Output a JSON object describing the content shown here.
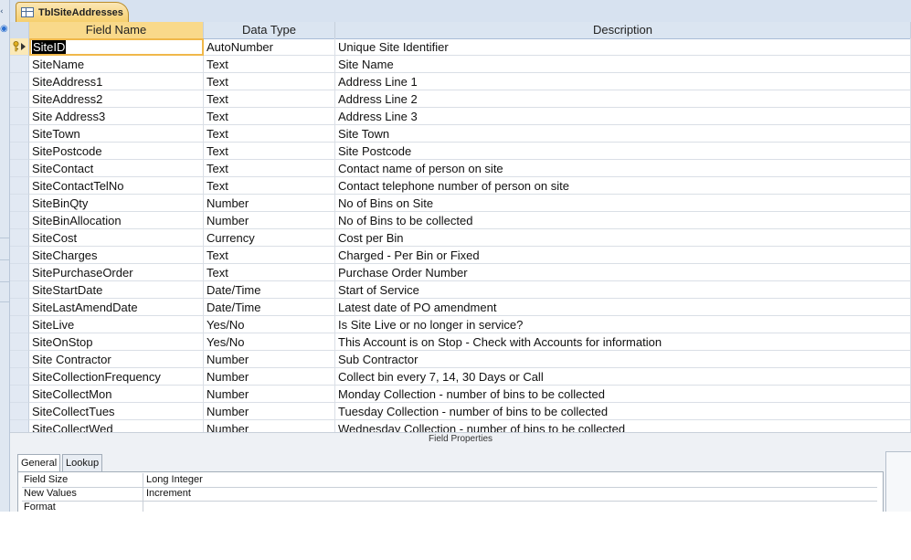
{
  "tab": {
    "title": "TblSiteAddresses"
  },
  "grid": {
    "headers": {
      "selector": "",
      "field_name": "Field Name",
      "data_type": "Data Type",
      "description": "Description"
    },
    "rows": [
      {
        "field": "SiteID",
        "type": "AutoNumber",
        "desc": "Unique Site Identifier"
      },
      {
        "field": "SiteName",
        "type": "Text",
        "desc": "Site Name"
      },
      {
        "field": "SiteAddress1",
        "type": "Text",
        "desc": "Address Line 1"
      },
      {
        "field": "SiteAddress2",
        "type": "Text",
        "desc": "Address Line 2"
      },
      {
        "field": "Site Address3",
        "type": "Text",
        "desc": "Address Line 3"
      },
      {
        "field": "SiteTown",
        "type": "Text",
        "desc": "Site Town"
      },
      {
        "field": "SitePostcode",
        "type": "Text",
        "desc": "Site Postcode"
      },
      {
        "field": "SiteContact",
        "type": "Text",
        "desc": "Contact name of person on site"
      },
      {
        "field": "SiteContactTelNo",
        "type": "Text",
        "desc": "Contact telephone number of person on site"
      },
      {
        "field": "SiteBinQty",
        "type": "Number",
        "desc": "No of Bins on Site"
      },
      {
        "field": "SiteBinAllocation",
        "type": "Number",
        "desc": "No of Bins to be collected"
      },
      {
        "field": "SiteCost",
        "type": "Currency",
        "desc": "Cost per Bin"
      },
      {
        "field": "SiteCharges",
        "type": "Text",
        "desc": "Charged - Per Bin or Fixed"
      },
      {
        "field": "SitePurchaseOrder",
        "type": "Text",
        "desc": "Purchase Order Number"
      },
      {
        "field": "SiteStartDate",
        "type": "Date/Time",
        "desc": "Start of Service"
      },
      {
        "field": "SiteLastAmendDate",
        "type": "Date/Time",
        "desc": "Latest date of PO amendment"
      },
      {
        "field": "SiteLive",
        "type": "Yes/No",
        "desc": "Is Site Live or no longer in service?"
      },
      {
        "field": "SiteOnStop",
        "type": "Yes/No",
        "desc": "This Account is on Stop - Check with Accounts for information"
      },
      {
        "field": "Site Contractor",
        "type": "Number",
        "desc": "Sub Contractor"
      },
      {
        "field": "SiteCollectionFrequency",
        "type": "Number",
        "desc": "Collect bin every 7, 14, 30 Days or Call"
      },
      {
        "field": "SiteCollectMon",
        "type": "Number",
        "desc": "Monday Collection - number of bins to be collected"
      },
      {
        "field": "SiteCollectTues",
        "type": "Number",
        "desc": "Tuesday Collection - number of bins to be collected"
      },
      {
        "field": "SiteCollectWed",
        "type": "Number",
        "desc": "Wednesday Collection - number of bins to be collected"
      }
    ]
  },
  "field_properties": {
    "title": "Field Properties",
    "tabs": [
      "General",
      "Lookup"
    ],
    "rows": [
      {
        "label": "Field Size",
        "value": "Long Integer"
      },
      {
        "label": "New Values",
        "value": "Increment"
      },
      {
        "label": "Format",
        "value": ""
      }
    ]
  },
  "colors": {
    "tab_accent": "#f6cf6d",
    "header_bg": "#dbe5f1",
    "selected_outline": "#f0b84a"
  }
}
